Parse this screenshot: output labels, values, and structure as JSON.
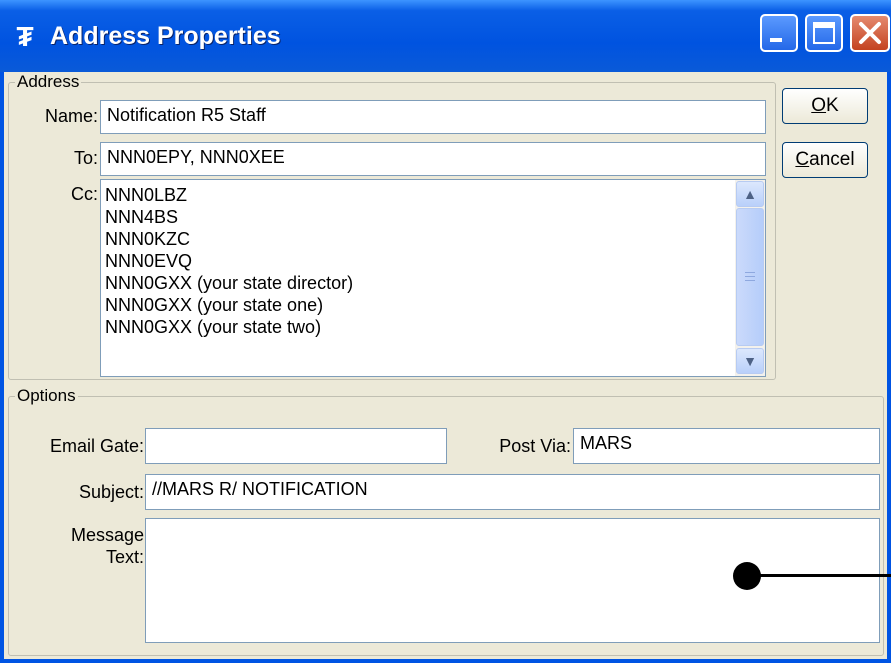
{
  "window": {
    "title": "Address Properties"
  },
  "address_group": {
    "legend": "Address",
    "name_label": "Name:",
    "name_value": "Notification R5 Staff",
    "to_label": "To:",
    "to_value": "NNN0EPY, NNN0XEE",
    "cc_label": "Cc:",
    "cc_lines": [
      "NNN0LBZ",
      "NNN4BS",
      "NNN0KZC",
      "NNN0EVQ",
      "NNN0GXX (your state director)",
      "NNN0GXX (your state one)",
      "NNN0GXX (your state two)"
    ]
  },
  "buttons": {
    "ok_label_prefix": "O",
    "ok_label_rest": "K",
    "cancel_label_prefix": "C",
    "cancel_label_rest": "ancel"
  },
  "options_group": {
    "legend": "Options",
    "email_gate_label": "Email Gate:",
    "email_gate_value": "",
    "post_via_label": "Post Via:",
    "post_via_value": "MARS",
    "subject_label": "Subject:",
    "subject_value": "//MARS R/ NOTIFICATION",
    "message_label_line1": "Message",
    "message_label_line2": "Text:",
    "message_value": ""
  },
  "icons": [
    "app-icon",
    "minimize-icon",
    "maximize-icon",
    "close-icon",
    "scroll-up-icon",
    "scroll-down-icon"
  ]
}
